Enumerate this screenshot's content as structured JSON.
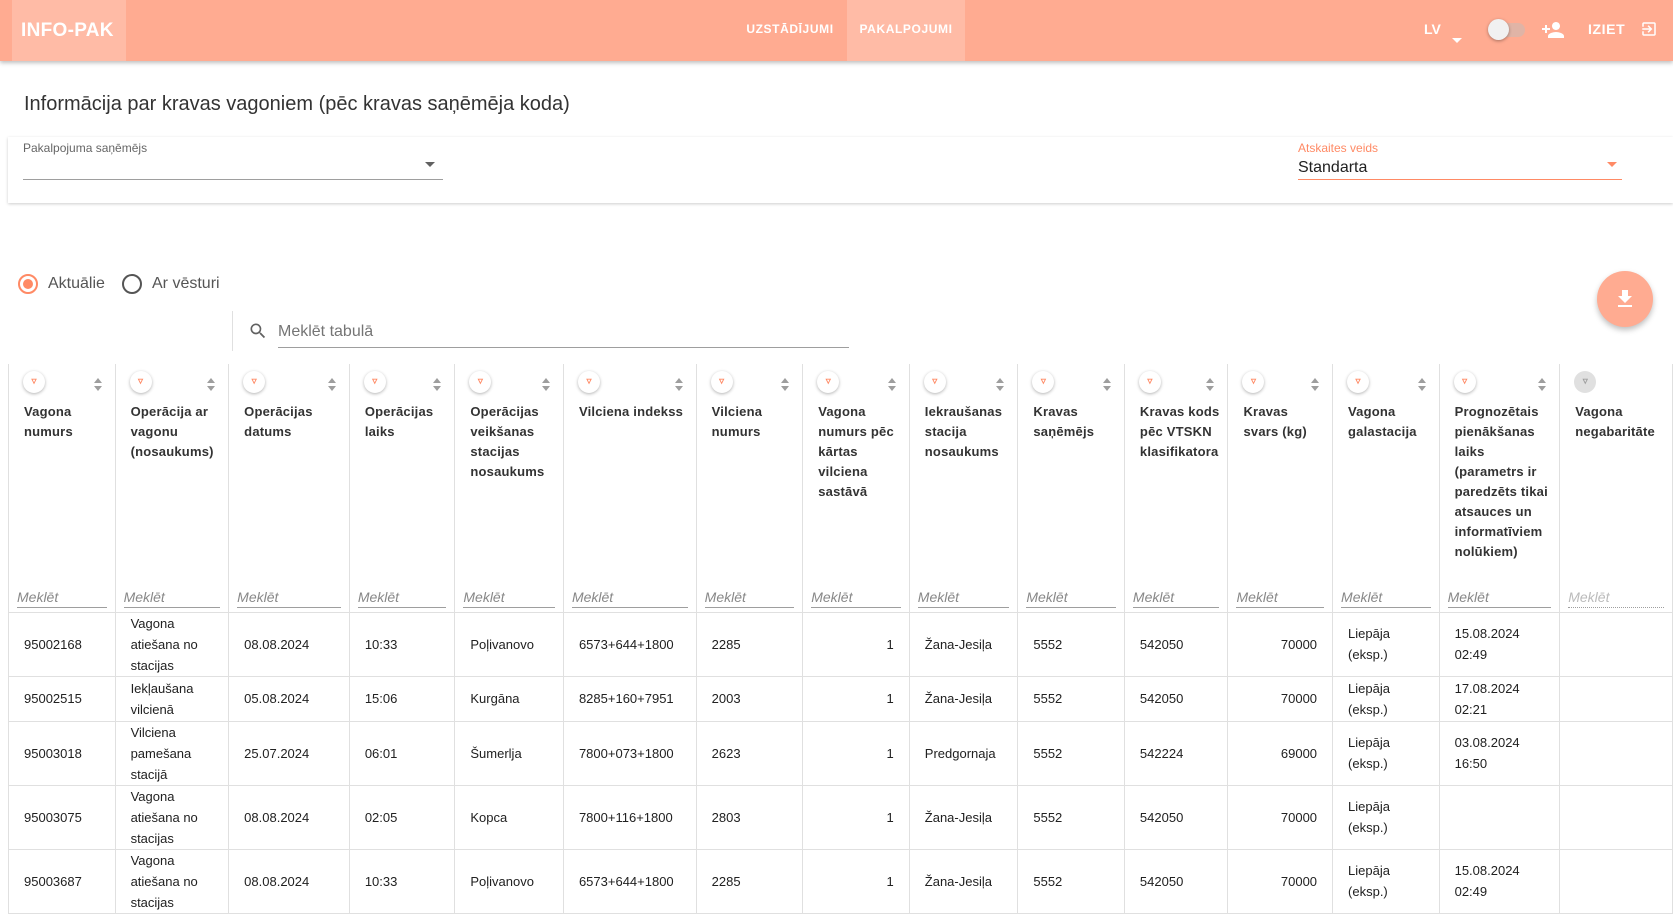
{
  "app": {
    "brand": "INFO-PAK"
  },
  "nav": {
    "settings": "UZSTĀDĪJUMI",
    "services": "PAKALPOJUMI"
  },
  "header": {
    "language": "LV",
    "logout": "IZIET"
  },
  "page": {
    "title": "Informācija par kravas vagoniem (pēc kravas saņēmēja koda)"
  },
  "filters": {
    "recipient_label": "Pakalpojuma saņēmējs",
    "recipient_value": "",
    "report_type_label": "Atskaites veids",
    "report_type_value": "Standarta"
  },
  "view_mode": {
    "current_label": "Aktuālie",
    "history_label": "Ar vēsturi",
    "selected": "current"
  },
  "search": {
    "placeholder": "Meklēt tabulā"
  },
  "colors": {
    "accent": "#ffab91",
    "accent_dark": "#ff8a65"
  },
  "table": {
    "filter_placeholder": "Meklēt",
    "columns": [
      "Vagona numurs",
      "Operācija ar vagonu (nosaukums)",
      "Operācijas datums",
      "Operācijas laiks",
      "Operācijas veikšanas stacijas nosaukums",
      "Vilciena indekss",
      "Vilciena numurs",
      "Vagona numurs pēc kārtas vilciena sastāvā",
      "Iekraušanas stacija nosaukums",
      "Kravas saņēmējs",
      "Kravas kods pēc VTSKN klasifikatora",
      "Kravas svars (kg)",
      "Vagona galastacija",
      "Prognozētais pienākšanas laiks (parametrs ir paredzēts tikai atsauces un informatīviem nolūkiem)",
      "Vagona negabaritāte"
    ],
    "rows": [
      [
        "95002168",
        "Vagona atiešana no stacijas",
        "08.08.2024",
        "10:33",
        "Poļivanovo",
        "6573+644+1800",
        "2285",
        "1",
        "Žana-Jesiļa",
        "5552",
        "542050",
        "70000",
        "Liepāja (eksp.)",
        "15.08.2024 02:49",
        ""
      ],
      [
        "95002515",
        "Iekļaušana vilcienā",
        "05.08.2024",
        "15:06",
        "Kurgāna",
        "8285+160+7951",
        "2003",
        "1",
        "Žana-Jesiļa",
        "5552",
        "542050",
        "70000",
        "Liepāja (eksp.)",
        "17.08.2024 02:21",
        ""
      ],
      [
        "95003018",
        "Vilciena pamešana stacijā",
        "25.07.2024",
        "06:01",
        "Šumerlja",
        "7800+073+1800",
        "2623",
        "1",
        "Predgornaja",
        "5552",
        "542224",
        "69000",
        "Liepāja (eksp.)",
        "03.08.2024 16:50",
        ""
      ],
      [
        "95003075",
        "Vagona atiešana no stacijas",
        "08.08.2024",
        "02:05",
        "Kopca",
        "7800+116+1800",
        "2803",
        "1",
        "Žana-Jesiļa",
        "5552",
        "542050",
        "70000",
        "Liepāja (eksp.)",
        "",
        ""
      ],
      [
        "95003687",
        "Vagona atiešana no stacijas",
        "08.08.2024",
        "10:33",
        "Poļivanovo",
        "6573+644+1800",
        "2285",
        "1",
        "Žana-Jesiļa",
        "5552",
        "542050",
        "70000",
        "Liepāja (eksp.)",
        "15.08.2024 02:49",
        ""
      ]
    ]
  }
}
